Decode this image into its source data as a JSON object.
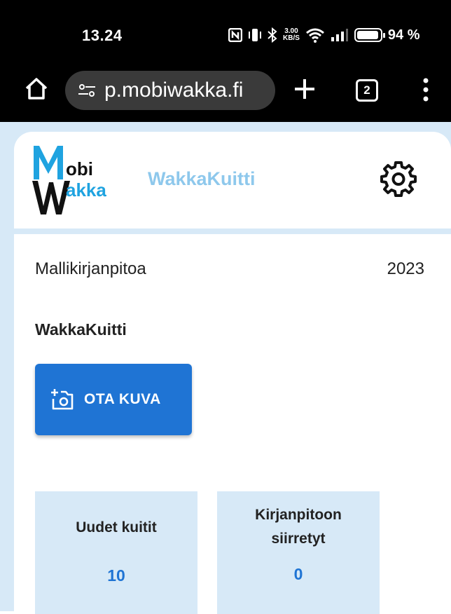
{
  "status_bar": {
    "time": "13.24",
    "speed_value": "3.00",
    "speed_unit": "KB/S",
    "battery": "94 %",
    "battery_level": 0.94
  },
  "browser": {
    "url": "p.mobiwakka.fi",
    "tab_count": "2"
  },
  "app": {
    "logo_line1": "obi",
    "logo_line2": "akka",
    "logo_brand": "MobiWakka",
    "title": "WakkaKuitti",
    "brand_color": "#1f74d4",
    "accent_color": "#8ec8ec"
  },
  "main": {
    "company": "Mallikirjanpitoa",
    "year": "2023",
    "section_title": "WakkaKuitti",
    "camera_button": "OTA KUVA",
    "stats": [
      {
        "label": "Uudet kuitit",
        "value": "10"
      },
      {
        "label": "Kirjanpitoon siirretyt",
        "value": "0"
      }
    ]
  }
}
